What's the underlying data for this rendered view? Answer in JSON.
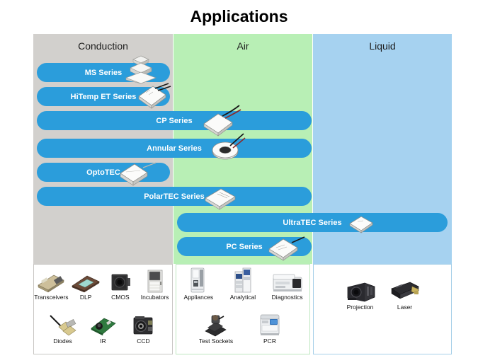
{
  "title": "Applications",
  "columns": [
    {
      "id": "conduction",
      "label": "Conduction",
      "color": "#d2d0cd"
    },
    {
      "id": "air",
      "label": "Air",
      "color": "#b8efb5"
    },
    {
      "id": "liquid",
      "label": "Liquid",
      "color": "#a6d2f0"
    }
  ],
  "accent": "#2b9ddb",
  "pills": [
    {
      "label": "MS Series",
      "icon": "stacked-tec-module-icon"
    },
    {
      "label": "HiTemp ET Series",
      "icon": "tec-module-wires-icon"
    },
    {
      "label": "CP Series",
      "icon": "tec-module-wires-icon"
    },
    {
      "label": "Annular Series",
      "icon": "annular-tec-ring-icon"
    },
    {
      "label": "OptoTEC",
      "icon": "opto-tec-module-icon"
    },
    {
      "label": "PolarTEC Series",
      "icon": "polar-tec-module-icon"
    },
    {
      "label": "UltraTEC Series",
      "icon": "ultra-tec-module-icon"
    },
    {
      "label": "PC Series",
      "icon": "pc-series-module-icon"
    }
  ],
  "applications": {
    "conduction": [
      {
        "label": "Transceivers",
        "icon": "transceiver-icon"
      },
      {
        "label": "DLP",
        "icon": "dlp-chip-icon"
      },
      {
        "label": "CMOS",
        "icon": "cmos-camera-icon"
      },
      {
        "label": "Incubators",
        "icon": "incubator-cabinet-icon"
      },
      {
        "label": "Diodes",
        "icon": "laser-diode-icon"
      },
      {
        "label": "IR",
        "icon": "ir-sensor-board-icon"
      },
      {
        "label": "CCD",
        "icon": "ccd-camera-icon"
      }
    ],
    "air": [
      {
        "label": "Appliances",
        "icon": "appliance-dispenser-icon"
      },
      {
        "label": "Analytical",
        "icon": "analytical-instrument-icon"
      },
      {
        "label": "Diagnostics",
        "icon": "diagnostics-analyzer-icon"
      },
      {
        "label": "Test Sockets",
        "icon": "test-socket-icon"
      },
      {
        "label": "PCR",
        "icon": "pcr-thermocycler-icon"
      }
    ],
    "liquid": [
      {
        "label": "Projection",
        "icon": "projector-icon"
      },
      {
        "label": "Laser",
        "icon": "laser-unit-icon"
      }
    ]
  }
}
